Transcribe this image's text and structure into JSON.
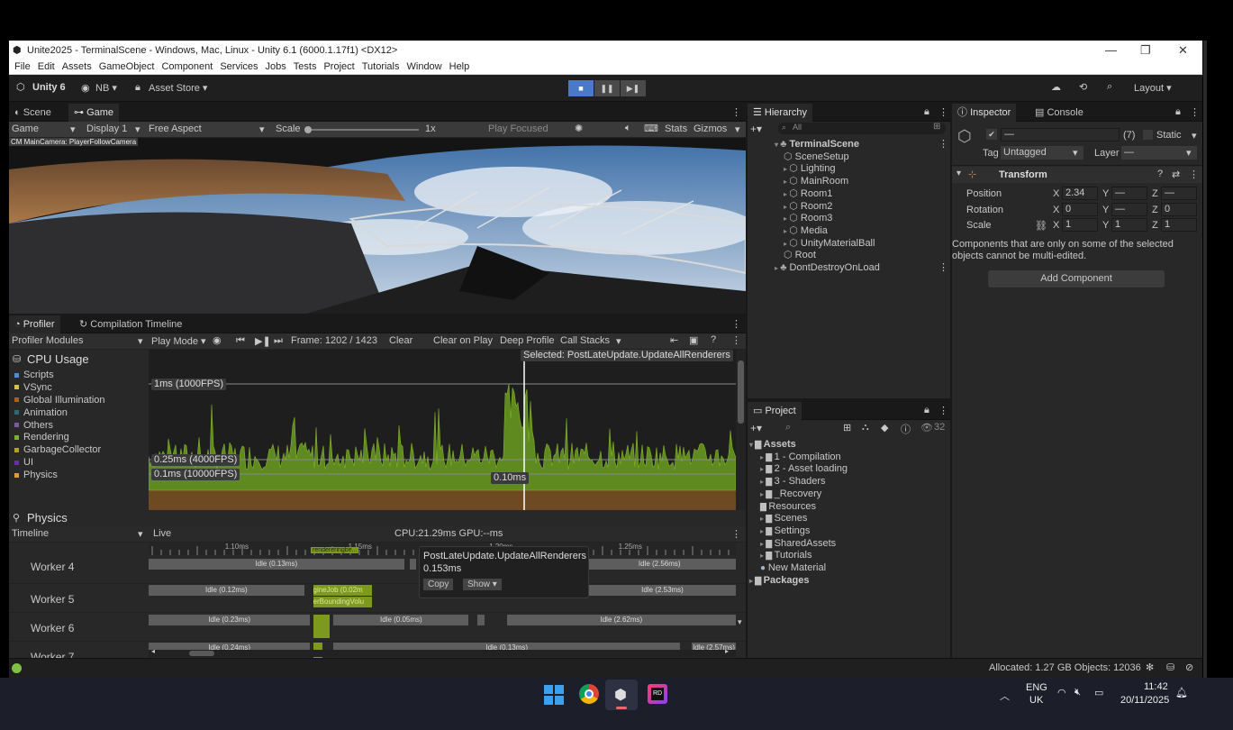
{
  "window": {
    "title": "Unite2025 - TerminalScene - Windows, Mac, Linux - Unity 6.1 (6000.1.17f1) <DX12>",
    "controls": [
      "—",
      "❐",
      "✕"
    ]
  },
  "menu": [
    "File",
    "Edit",
    "Assets",
    "GameObject",
    "Component",
    "Services",
    "Jobs",
    "Tests",
    "Project",
    "Tutorials",
    "Window",
    "Help"
  ],
  "toolbar": {
    "unity_label": "Unity 6",
    "account_label": "NB ▾",
    "asset_store_label": "Asset Store ▾",
    "layout_label": "Layout ▾"
  },
  "scene_view": {
    "tabs": [
      "Scene",
      "Game"
    ],
    "game_label": "Game",
    "display_label": "Display 1",
    "aspect_label": "Free Aspect",
    "scale_label": "Scale",
    "scale_value": "1x",
    "play_focused": "Play Focused",
    "stats_label": "Stats",
    "gizmos_label": "Gizmos",
    "camera_label": "CM MainCamera: PlayerFollowCamera"
  },
  "profiler": {
    "tabs": [
      "Profiler",
      "Compilation Timeline"
    ],
    "modules_label": "Profiler Modules",
    "play_mode_label": "Play Mode ▾",
    "frame_label": "Frame: 1202 / 1423",
    "clear_label": "Clear",
    "clear_on_play_label": "Clear on Play",
    "deep_profile_label": "Deep Profile",
    "call_stacks_label": "Call Stacks",
    "cpu_usage_title": "CPU Usage",
    "legend": [
      {
        "name": "Scripts",
        "color": "#4a8ed4"
      },
      {
        "name": "VSync",
        "color": "#d7c24a"
      },
      {
        "name": "Global Illumination",
        "color": "#b05d25"
      },
      {
        "name": "Animation",
        "color": "#2d6a73"
      },
      {
        "name": "Others",
        "color": "#7b5a9e"
      },
      {
        "name": "Rendering",
        "color": "#7fb02b"
      },
      {
        "name": "GarbageCollector",
        "color": "#b3a12b"
      },
      {
        "name": "UI",
        "color": "#6a2fa0"
      },
      {
        "name": "Physics",
        "color": "#d9a02e"
      }
    ],
    "physics_title": "Physics",
    "timeline_label": "Timeline",
    "live_label": "Live",
    "cpu_gpu_label": "CPU:21.29ms   GPU:--ms",
    "selected_label": "Selected: PostLateUpdate.UpdateAllRenderers",
    "line_1ms": "1ms (1000FPS)",
    "line_025ms": "0.25ms (4000FPS)",
    "line_01ms": "0.1ms (10000FPS)",
    "cursor_value": "0.10ms",
    "ruler": [
      "1.10ms",
      "1.15ms",
      "1.20ms",
      "1.25ms"
    ],
    "ruler_positions": [
      0.13,
      0.34,
      0.58,
      0.8
    ],
    "ruler_note": "rendereringbe...",
    "workers": [
      {
        "name": "Worker 4",
        "bars": [
          {
            "label": "Idle (0.13ms)",
            "x": 0,
            "w": 0.435,
            "green": false
          },
          {
            "label": "",
            "x": 0.445,
            "w": 0.01,
            "green": false
          },
          {
            "label": "Idle (2.56ms)",
            "x": 0.74,
            "w": 0.26,
            "green": false
          }
        ]
      },
      {
        "name": "Worker 5",
        "bars": [
          {
            "label": "Idle (0.12ms)",
            "x": 0,
            "w": 0.265,
            "green": false
          },
          {
            "label": "gineJob (0.02m",
            "x": 0.28,
            "w": 0.1,
            "green": true
          },
          {
            "label": "Idle (2.53ms)",
            "x": 0.75,
            "w": 0.25,
            "green": false
          }
        ]
      },
      {
        "name": "Worker 6",
        "bars": [
          {
            "label": "Idle (0.23ms)",
            "x": 0,
            "w": 0.275,
            "green": false
          },
          {
            "label": "",
            "x": 0.28,
            "w": 0.028,
            "green": true
          },
          {
            "label": "Idle (0.05ms)",
            "x": 0.315,
            "w": 0.23,
            "green": false
          },
          {
            "label": "",
            "x": 0.56,
            "w": 0.012,
            "green": false
          },
          {
            "label": "Idle (2.62ms)",
            "x": 0.61,
            "w": 0.39,
            "green": false
          }
        ]
      },
      {
        "name": "Worker 7",
        "bars": [
          {
            "label": "Idle (0.24ms)",
            "x": 0,
            "w": 0.275,
            "green": false
          },
          {
            "label": "",
            "x": 0.28,
            "w": 0.016,
            "green": true
          },
          {
            "label": "Idle (0.13ms)",
            "x": 0.315,
            "w": 0.59,
            "green": false
          },
          {
            "label": "Idle (2.57ms)",
            "x": 0.925,
            "w": 0.075,
            "green": false
          }
        ]
      }
    ],
    "worker5_sub": "erBoundingVolu",
    "tooltip": {
      "title": "PostLateUpdate.UpdateAllRenderers",
      "value": "0.153ms",
      "copy": "Copy",
      "show": "Show ▾"
    }
  },
  "hierarchy": {
    "tab": "Hierarchy",
    "search_placeholder": "All",
    "items": [
      {
        "label": "TerminalScene",
        "level": 0,
        "icon": "scene"
      },
      {
        "label": "SceneSetup",
        "level": 1,
        "icon": "cube"
      },
      {
        "label": "Lighting",
        "level": 1,
        "icon": "cube"
      },
      {
        "label": "MainRoom",
        "level": 1,
        "icon": "cube"
      },
      {
        "label": "Room1",
        "level": 1,
        "icon": "cube"
      },
      {
        "label": "Room2",
        "level": 1,
        "icon": "cube"
      },
      {
        "label": "Room3",
        "level": 1,
        "icon": "cube"
      },
      {
        "label": "Media",
        "level": 1,
        "icon": "cube"
      },
      {
        "label": "UnityMaterialBall",
        "level": 1,
        "icon": "cube"
      },
      {
        "label": "Root",
        "level": 1,
        "icon": "cube"
      },
      {
        "label": "DontDestroyOnLoad",
        "level": 0,
        "icon": "scene"
      }
    ]
  },
  "project": {
    "tab": "Project",
    "count": "32",
    "items": [
      {
        "label": "Assets",
        "level": 0
      },
      {
        "label": "1 - Compilation",
        "level": 1
      },
      {
        "label": "2 - Asset loading",
        "level": 1
      },
      {
        "label": "3 - Shaders",
        "level": 1
      },
      {
        "label": "_Recovery",
        "level": 1
      },
      {
        "label": "Resources",
        "level": 1
      },
      {
        "label": "Scenes",
        "level": 1
      },
      {
        "label": "Settings",
        "level": 1
      },
      {
        "label": "SharedAssets",
        "level": 1
      },
      {
        "label": "Tutorials",
        "level": 1
      },
      {
        "label": "New Material",
        "level": 1
      },
      {
        "label": "Packages",
        "level": 0
      }
    ]
  },
  "inspector": {
    "tabs": [
      "Inspector",
      "Console"
    ],
    "name_value": "—",
    "count": "(7)",
    "static_label": "Static",
    "tag_label": "Tag",
    "tag_value": "Untagged",
    "layer_label": "Layer",
    "layer_value": "—",
    "transform_label": "Transform",
    "rows": [
      {
        "label": "Position",
        "x": "2.34",
        "y": "—",
        "z": "—"
      },
      {
        "label": "Rotation",
        "x": "0",
        "y": "—",
        "z": "0"
      },
      {
        "label": "Scale",
        "x": "1",
        "y": "1",
        "z": "1"
      }
    ],
    "axis_labels": [
      "X",
      "Y",
      "Z"
    ],
    "note": "Components that are only on some of the selected objects cannot be multi-edited.",
    "add_component": "Add Component"
  },
  "status": {
    "allocated": "Allocated: 1.27 GB Objects: 12036"
  },
  "taskbar": {
    "lang": "ENG",
    "region": "UK",
    "time": "11:42",
    "date": "20/11/2025"
  }
}
